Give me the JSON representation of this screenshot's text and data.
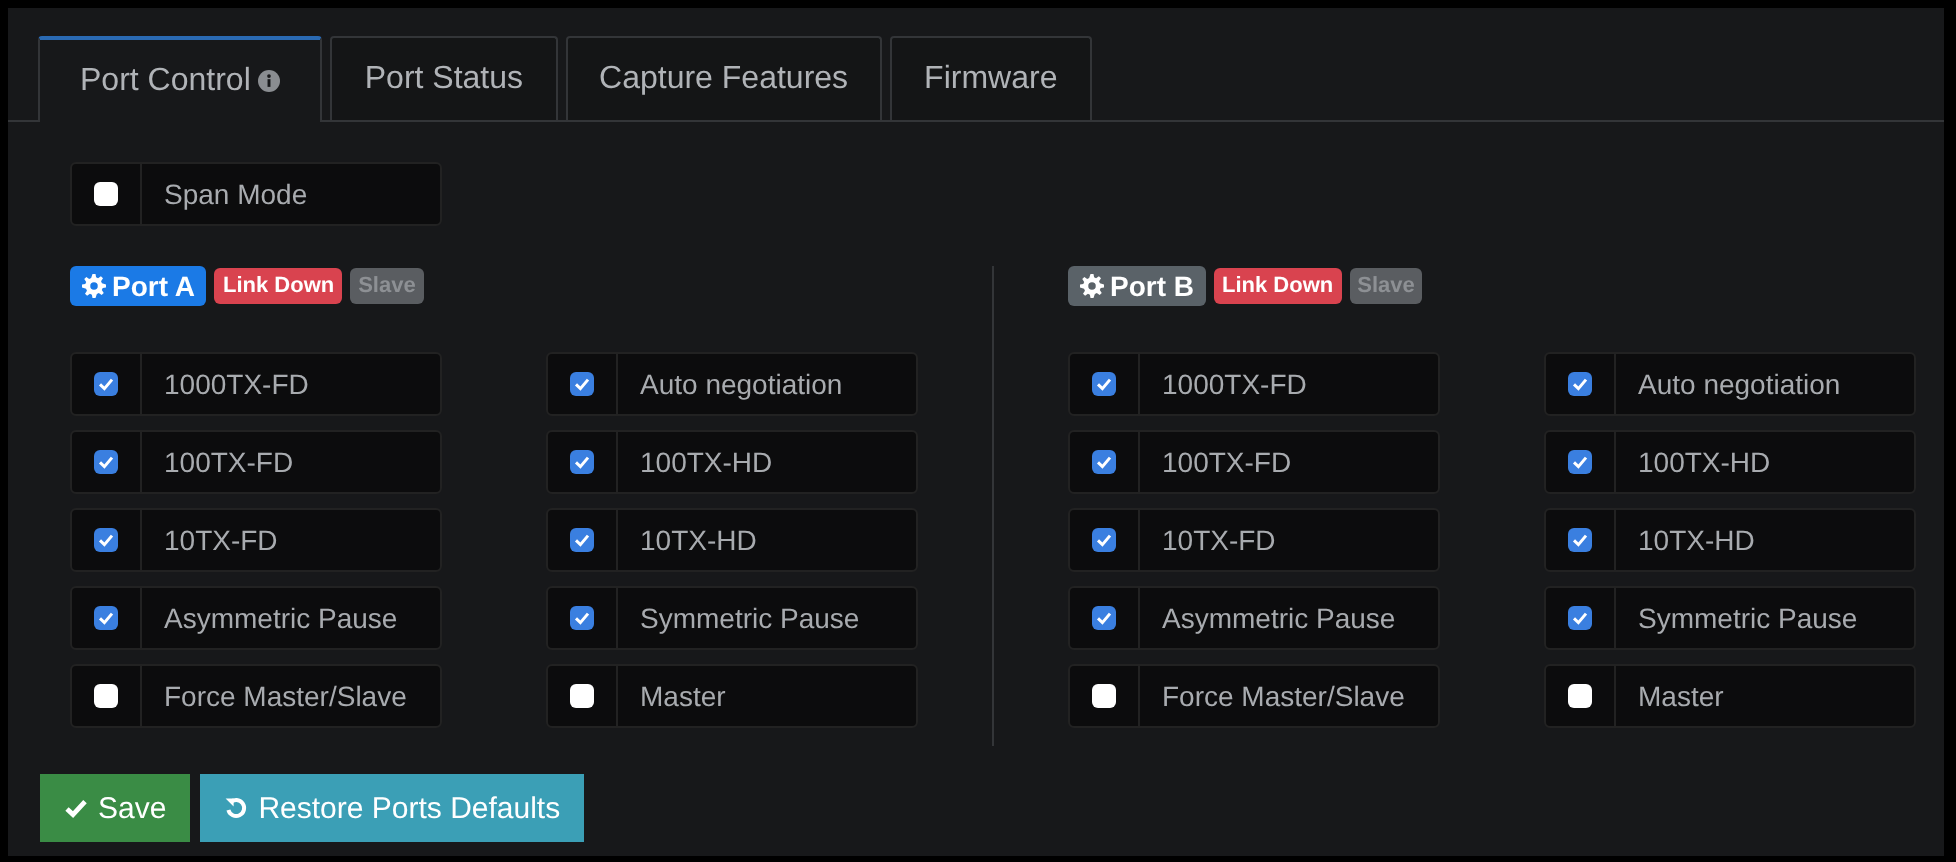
{
  "tabs": [
    {
      "label": "Port Control",
      "selected": true,
      "info": true
    },
    {
      "label": "Port Status",
      "selected": false,
      "info": false
    },
    {
      "label": "Capture Features",
      "selected": false,
      "info": false
    },
    {
      "label": "Firmware",
      "selected": false,
      "info": false
    }
  ],
  "span_mode": {
    "label": "Span Mode",
    "checked": false
  },
  "ports": [
    {
      "name": "Port A",
      "selected": true,
      "badges": [
        {
          "label": "Link Down",
          "color": "#d9434f"
        },
        {
          "label": "Slave",
          "color": "#5a5d61"
        }
      ],
      "options": [
        {
          "label": "1000TX-FD",
          "checked": true
        },
        {
          "label": "Auto negotiation",
          "checked": true
        },
        {
          "label": "100TX-FD",
          "checked": true
        },
        {
          "label": "100TX-HD",
          "checked": true
        },
        {
          "label": "10TX-FD",
          "checked": true
        },
        {
          "label": "10TX-HD",
          "checked": true
        },
        {
          "label": "Asymmetric Pause",
          "checked": true
        },
        {
          "label": "Symmetric Pause",
          "checked": true
        },
        {
          "label": "Force Master/Slave",
          "checked": false
        },
        {
          "label": "Master",
          "checked": false
        }
      ]
    },
    {
      "name": "Port B",
      "selected": false,
      "badges": [
        {
          "label": "Link Down",
          "color": "#d9434f"
        },
        {
          "label": "Slave",
          "color": "#5a5d61"
        }
      ],
      "options": [
        {
          "label": "1000TX-FD",
          "checked": true
        },
        {
          "label": "Auto negotiation",
          "checked": true
        },
        {
          "label": "100TX-FD",
          "checked": true
        },
        {
          "label": "100TX-HD",
          "checked": true
        },
        {
          "label": "10TX-FD",
          "checked": true
        },
        {
          "label": "10TX-HD",
          "checked": true
        },
        {
          "label": "Asymmetric Pause",
          "checked": true
        },
        {
          "label": "Symmetric Pause",
          "checked": true
        },
        {
          "label": "Force Master/Slave",
          "checked": false
        },
        {
          "label": "Master",
          "checked": false
        }
      ]
    }
  ],
  "buttons": [
    {
      "label": "Save",
      "kind": "save"
    },
    {
      "label": "Restore Ports Defaults",
      "kind": "restore"
    }
  ]
}
